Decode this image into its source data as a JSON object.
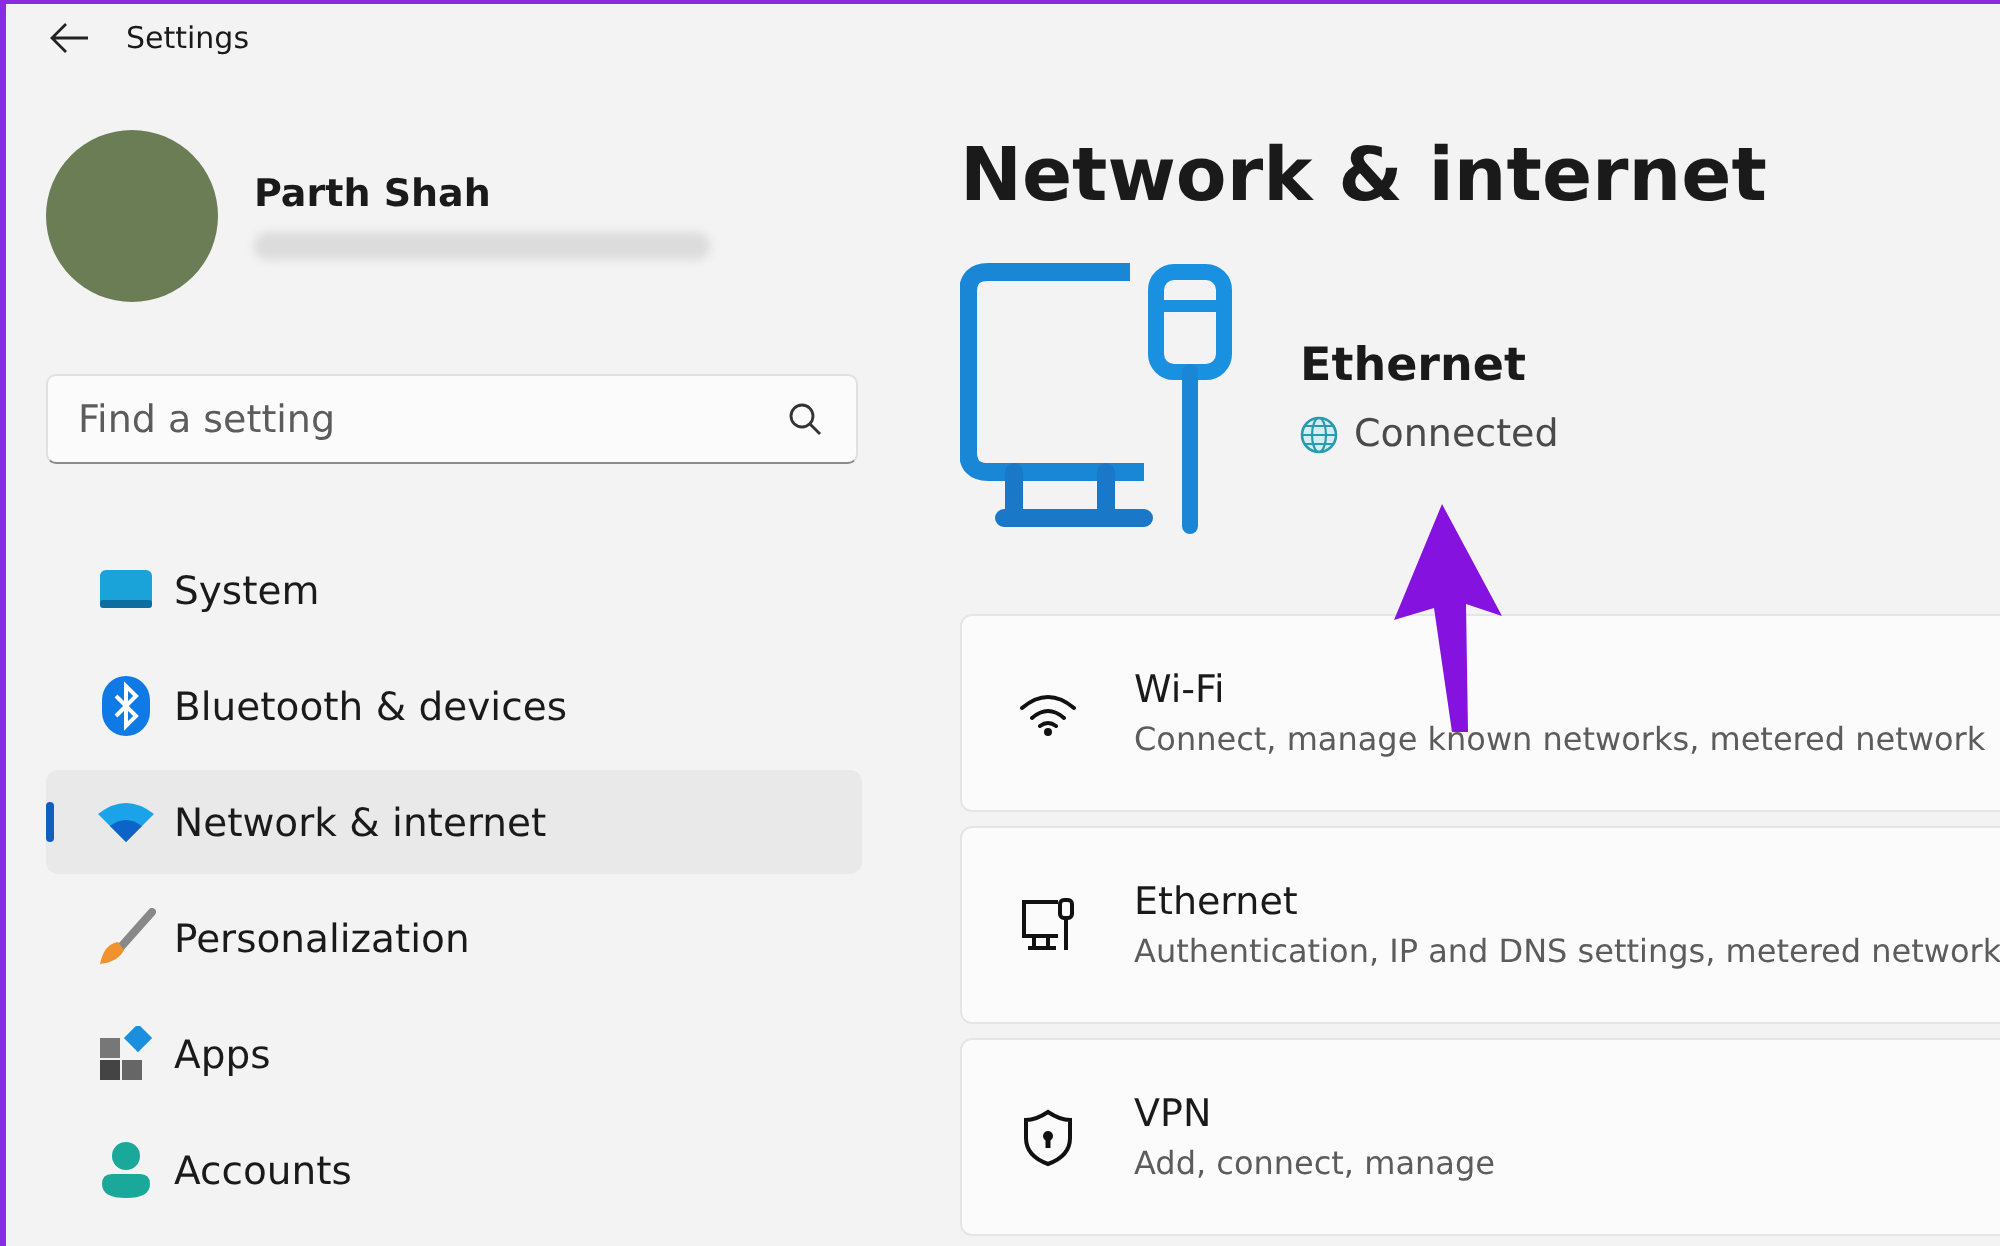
{
  "window": {
    "title": "Settings"
  },
  "account": {
    "name": "Parth Shah"
  },
  "search": {
    "placeholder": "Find a setting"
  },
  "sidebar": {
    "items": [
      {
        "label": "System",
        "selected": false
      },
      {
        "label": "Bluetooth & devices",
        "selected": false
      },
      {
        "label": "Network & internet",
        "selected": true
      },
      {
        "label": "Personalization",
        "selected": false
      },
      {
        "label": "Apps",
        "selected": false
      },
      {
        "label": "Accounts",
        "selected": false
      }
    ]
  },
  "page": {
    "title": "Network & internet",
    "connection": {
      "name": "Ethernet",
      "status": "Connected"
    }
  },
  "cards": [
    {
      "title": "Wi-Fi",
      "description": "Connect, manage known networks, metered network"
    },
    {
      "title": "Ethernet",
      "description": "Authentication, IP and DNS settings, metered network"
    },
    {
      "title": "VPN",
      "description": "Add, connect, manage"
    }
  ]
}
